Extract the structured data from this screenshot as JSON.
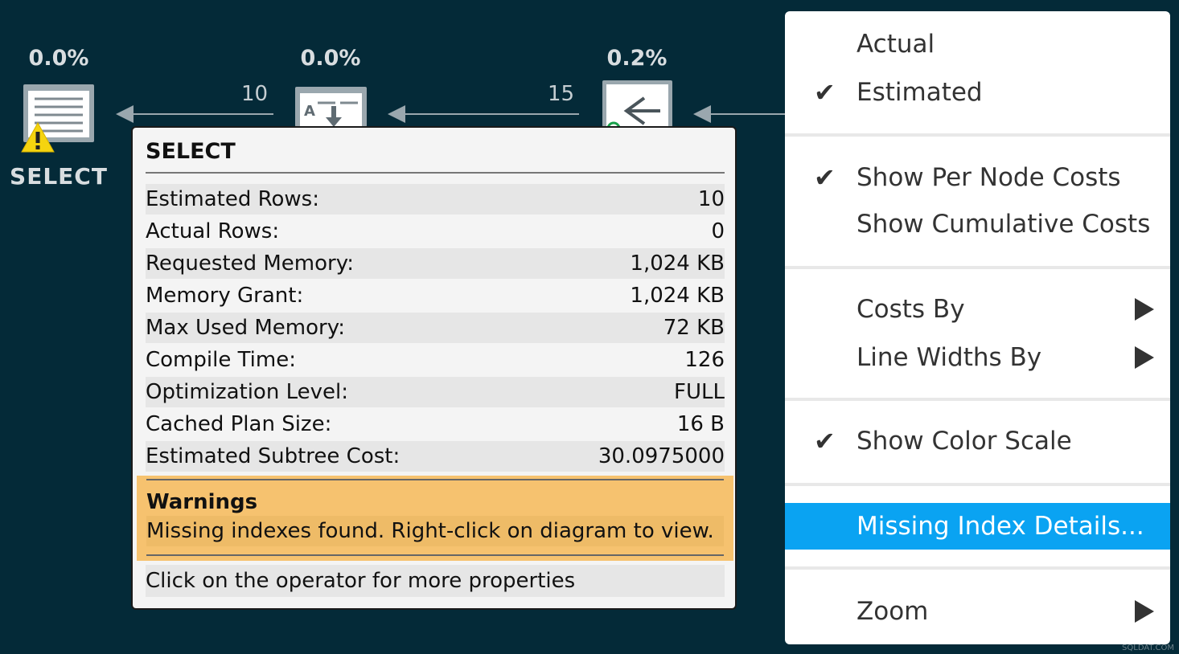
{
  "plan": {
    "nodes": [
      {
        "pct": "0.0%",
        "label": "SELECT"
      },
      {
        "pct": "0.0%"
      },
      {
        "pct": "0.2%"
      }
    ],
    "arrows": [
      "10",
      "15"
    ]
  },
  "tooltip": {
    "title": "SELECT",
    "rows": [
      {
        "key": "Estimated Rows:",
        "value": "10"
      },
      {
        "key": "Actual Rows:",
        "value": "0"
      },
      {
        "key": "Requested Memory:",
        "value": "1,024 KB"
      },
      {
        "key": "Memory Grant:",
        "value": "1,024 KB"
      },
      {
        "key": "Max Used Memory:",
        "value": "72 KB"
      },
      {
        "key": "Compile Time:",
        "value": "126"
      },
      {
        "key": "Optimization Level:",
        "value": "FULL"
      },
      {
        "key": "Cached Plan Size:",
        "value": "16 B"
      },
      {
        "key": "Estimated Subtree Cost:",
        "value": "30.0975000"
      }
    ],
    "warnings_title": "Warnings",
    "warnings_text": "Missing indexes found. Right-click on diagram to view.",
    "footer": "Click on the operator for more properties"
  },
  "menu": {
    "actual": "Actual",
    "estimated": "Estimated",
    "show_per_node_costs": "Show Per Node Costs",
    "show_cumulative_costs": "Show Cumulative Costs",
    "costs_by": "Costs By",
    "line_widths_by": "Line Widths By",
    "show_color_scale": "Show Color Scale",
    "missing_index_details": "Missing Index Details...",
    "zoom": "Zoom",
    "checkmark": "✔"
  },
  "watermark": "SQLDAT.COM",
  "colors": {
    "background": "#042a38",
    "highlight": "#0aa3f2",
    "warning": "#f6c26f"
  }
}
